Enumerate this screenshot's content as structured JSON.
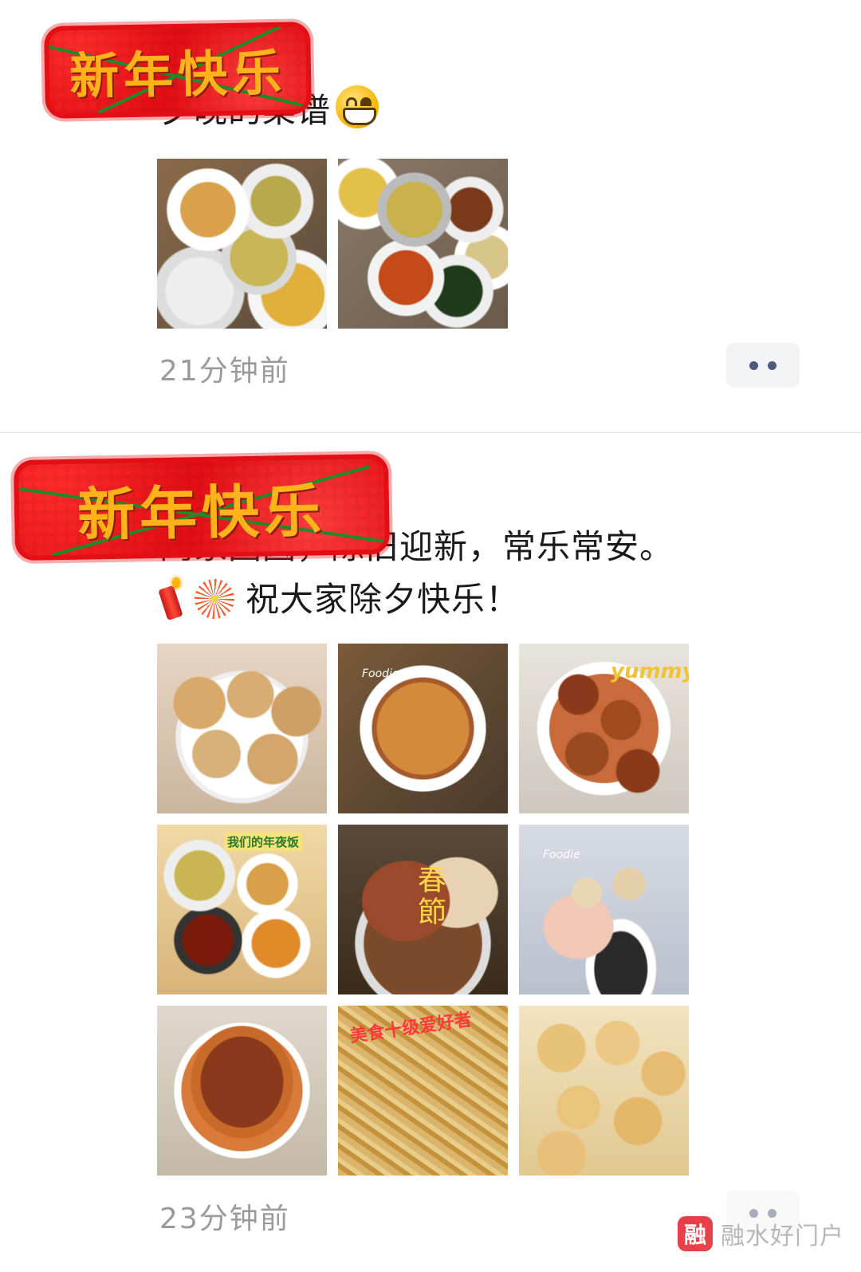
{
  "posts": [
    {
      "sticker_text": "新年快乐",
      "text_lines": [
        "夕晚的菜谱"
      ],
      "time": "21分钟前",
      "images": [
        {
          "icon": "food-photo-table-feast"
        },
        {
          "icon": "food-photo-table-feast"
        }
      ]
    },
    {
      "sticker_text": "新年快乐",
      "text_lines": [
        "阖家团圆，除旧迎新，常乐常安。",
        "祝大家除夕快乐！"
      ],
      "time": "23分钟前",
      "images": [
        {
          "icon": "food-photo-buns"
        },
        {
          "icon": "food-photo-fried-meat",
          "caption": "Foodie"
        },
        {
          "icon": "food-photo-fried-chicken",
          "caption": "yummy"
        },
        {
          "icon": "food-photo-table-feast",
          "caption": "我们的年夜饭"
        },
        {
          "icon": "food-photo-pork-knuckle",
          "caption": "春節"
        },
        {
          "icon": "food-photo-toast",
          "caption": "Foodie"
        },
        {
          "icon": "food-photo-fish"
        },
        {
          "icon": "food-photo-noodles",
          "caption": "美食十级爱好者"
        },
        {
          "icon": "food-photo-fried-balls"
        }
      ]
    }
  ],
  "watermark": {
    "logo": "融",
    "text": "融水好门户"
  },
  "colors": {
    "sticker_red": "#e40f15",
    "sticker_text": "#ffb21a",
    "time_gray": "#9a9a9a",
    "more_btn_bg": "#f2f3f5"
  }
}
